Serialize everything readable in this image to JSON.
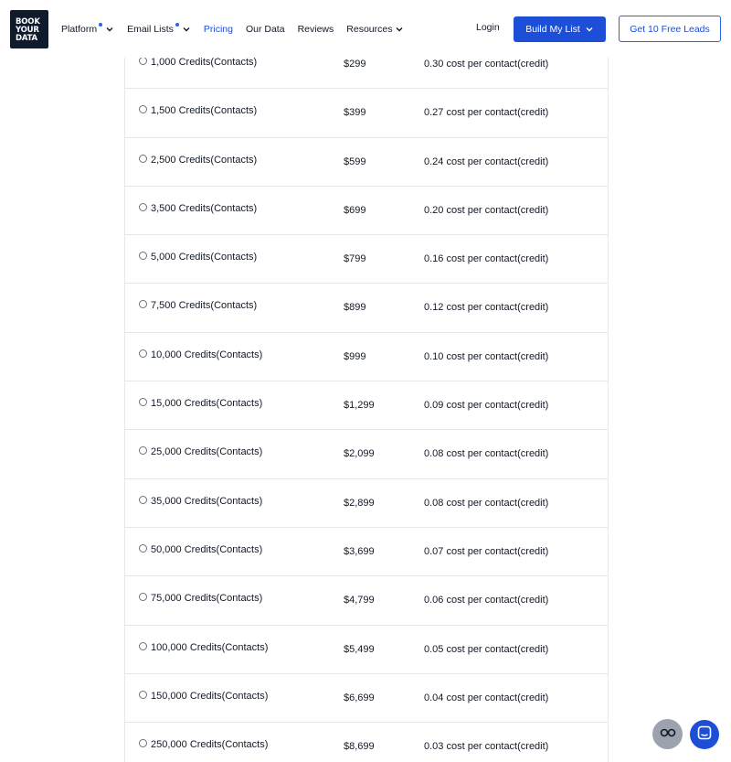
{
  "logo": {
    "lines": [
      "BOOK",
      "YOUR",
      "DATA"
    ]
  },
  "nav": {
    "items": [
      {
        "label": "Platform",
        "dot": true,
        "dropdown": true,
        "active": false
      },
      {
        "label": "Email Lists",
        "dot": true,
        "dropdown": true,
        "active": false
      },
      {
        "label": "Pricing",
        "dot": false,
        "dropdown": false,
        "active": true
      },
      {
        "label": "Our Data",
        "dot": false,
        "dropdown": false,
        "active": false
      },
      {
        "label": "Reviews",
        "dot": false,
        "dropdown": false,
        "active": false
      },
      {
        "label": "Resources",
        "dot": false,
        "dropdown": true,
        "active": false
      }
    ],
    "login": "Login",
    "primary_button": "Build My List",
    "outline_button": "Get 10 Free Leads"
  },
  "colors": {
    "brand_blue": "#1d4ed8",
    "logo_bg": "#0f1b2d",
    "fab_grey": "#9ca3af"
  },
  "pricing_rows": [
    {
      "credits": "1,000 Credits(Contacts)",
      "price": "$299",
      "cost": "0.30 cost per contact(credit)"
    },
    {
      "credits": "1,500 Credits(Contacts)",
      "price": "$399",
      "cost": "0.27 cost per contact(credit)"
    },
    {
      "credits": "2,500 Credits(Contacts)",
      "price": "$599",
      "cost": "0.24 cost per contact(credit)"
    },
    {
      "credits": "3,500 Credits(Contacts)",
      "price": "$699",
      "cost": "0.20 cost per contact(credit)"
    },
    {
      "credits": "5,000 Credits(Contacts)",
      "price": "$799",
      "cost": "0.16 cost per contact(credit)"
    },
    {
      "credits": "7,500 Credits(Contacts)",
      "price": "$899",
      "cost": "0.12 cost per contact(credit)"
    },
    {
      "credits": "10,000 Credits(Contacts)",
      "price": "$999",
      "cost": "0.10 cost per contact(credit)"
    },
    {
      "credits": "15,000 Credits(Contacts)",
      "price": "$1,299",
      "cost": "0.09 cost per contact(credit)"
    },
    {
      "credits": "25,000 Credits(Contacts)",
      "price": "$2,099",
      "cost": "0.08 cost per contact(credit)"
    },
    {
      "credits": "35,000 Credits(Contacts)",
      "price": "$2,899",
      "cost": "0.08 cost per contact(credit)"
    },
    {
      "credits": "50,000 Credits(Contacts)",
      "price": "$3,699",
      "cost": "0.07 cost per contact(credit)"
    },
    {
      "credits": "75,000 Credits(Contacts)",
      "price": "$4,799",
      "cost": "0.06 cost per contact(credit)"
    },
    {
      "credits": "100,000 Credits(Contacts)",
      "price": "$5,499",
      "cost": "0.05 cost per contact(credit)"
    },
    {
      "credits": "150,000 Credits(Contacts)",
      "price": "$6,699",
      "cost": "0.04 cost per contact(credit)"
    },
    {
      "credits": "250,000 Credits(Contacts)",
      "price": "$8,699",
      "cost": "0.03 cost per contact(credit)"
    }
  ],
  "floating": {
    "left_icon": "glasses-icon",
    "right_icon": "chat-icon"
  }
}
